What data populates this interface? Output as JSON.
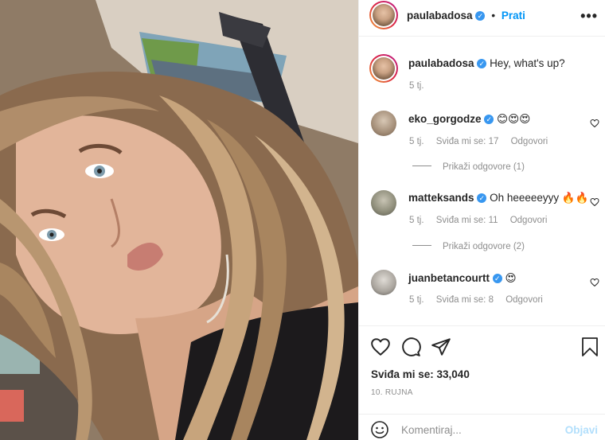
{
  "post": {
    "author": "paulabadosa",
    "follow_label": "Prati",
    "caption": "Hey, what's up?",
    "caption_time": "5 tj.",
    "likes_text": "Sviđa mi se: 33,040",
    "date": "10. RUJNA",
    "comment_placeholder": "Komentiraj...",
    "post_label": "Objavi"
  },
  "comments": [
    {
      "user": "eko_gorgodze",
      "verified": true,
      "text": "😊😍😍",
      "time": "5 tj.",
      "likes": "Sviđa mi se: 17",
      "reply": "Odgovori",
      "view_replies": "Prikaži odgovore (1)"
    },
    {
      "user": "matteksands",
      "verified": true,
      "text": "Oh heeeeeyyy 🔥🔥",
      "time": "5 tj.",
      "likes": "Sviđa mi se: 11",
      "reply": "Odgovori",
      "view_replies": "Prikaži odgovore (2)"
    },
    {
      "user": "juanbetancourtt",
      "verified": true,
      "text": "😍",
      "time": "5 tj.",
      "likes": "Sviđa mi se: 8",
      "reply": "Odgovori"
    }
  ],
  "icons": {
    "more": "more-options-icon",
    "like": "heart-icon",
    "comment": "comment-bubble-icon",
    "share": "paper-plane-icon",
    "save": "bookmark-icon",
    "emoji": "smiley-icon",
    "verified": "verified-badge-icon"
  },
  "colors": {
    "follow": "#0095f6",
    "verified": "#3897f0",
    "muted": "#8e8e8e",
    "post_disabled": "#b2dffc"
  }
}
